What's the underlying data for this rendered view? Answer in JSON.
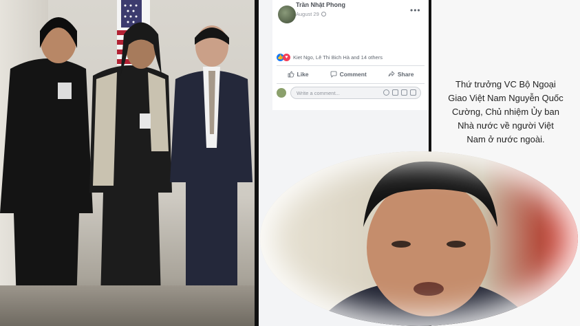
{
  "facebook_post": {
    "author": "Trần Nhật Phong",
    "date": "August 29",
    "reactions_text": "Kiet Ngo, Lê Thi Bich Hà and 14 others",
    "actions": {
      "like": "Like",
      "comment": "Comment",
      "share": "Share"
    },
    "comment_placeholder": "Write a comment..."
  },
  "caption": {
    "line1": "Thứ trưởng VC Bộ Ngoại",
    "line2": "Giao Việt Nam Nguyễn Quốc",
    "line3": "Cường, Chủ nhiệm Ủy ban",
    "line4": "Nhà nước về người Việt",
    "line5": "Nam ở nước ngoài."
  },
  "colors": {
    "fb_blue": "#1877f2",
    "love_red": "#f33e58",
    "flag_red": "#b22234",
    "flag_blue": "#3c3b6e"
  }
}
